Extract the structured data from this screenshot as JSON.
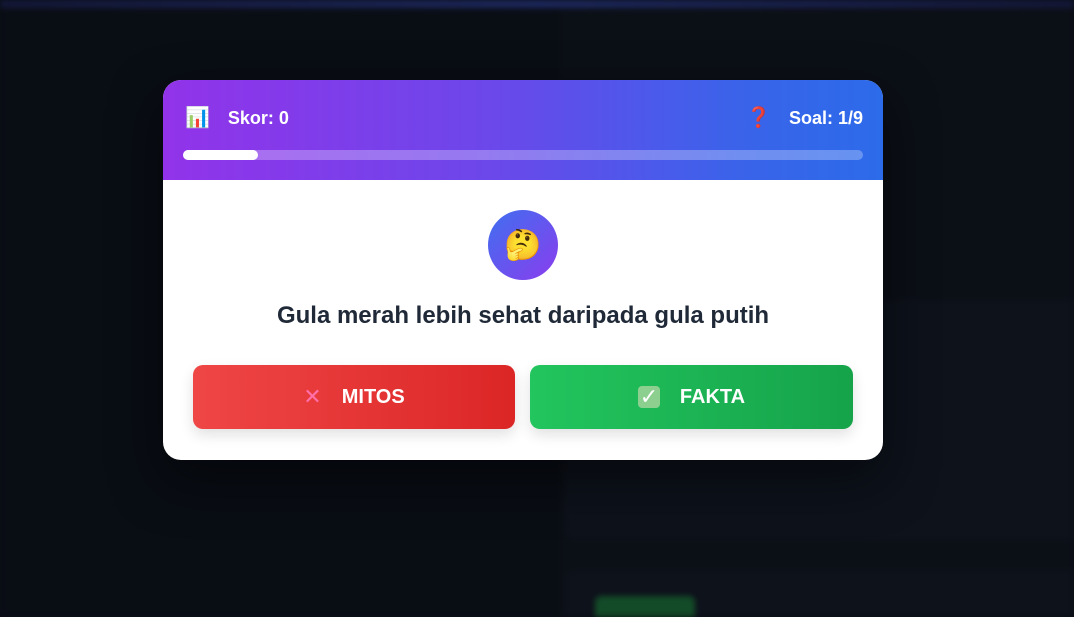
{
  "header": {
    "score_icon": "bar-chart-icon",
    "score_label": "Skor: 0",
    "question_icon": "question-mark-icon",
    "question_counter": "Soal: 1/9",
    "progress": 0.111
  },
  "question": {
    "emoji": "🤔",
    "text": "Gula merah lebih sehat daripada gula putih"
  },
  "answers": {
    "myth_label": "MITOS",
    "fact_label": "FAKTA"
  },
  "colors": {
    "header_gradient_start": "#9233ea",
    "header_gradient_end": "#2c6bea",
    "myth_button": "#ef4444",
    "fact_button": "#22c55e"
  }
}
